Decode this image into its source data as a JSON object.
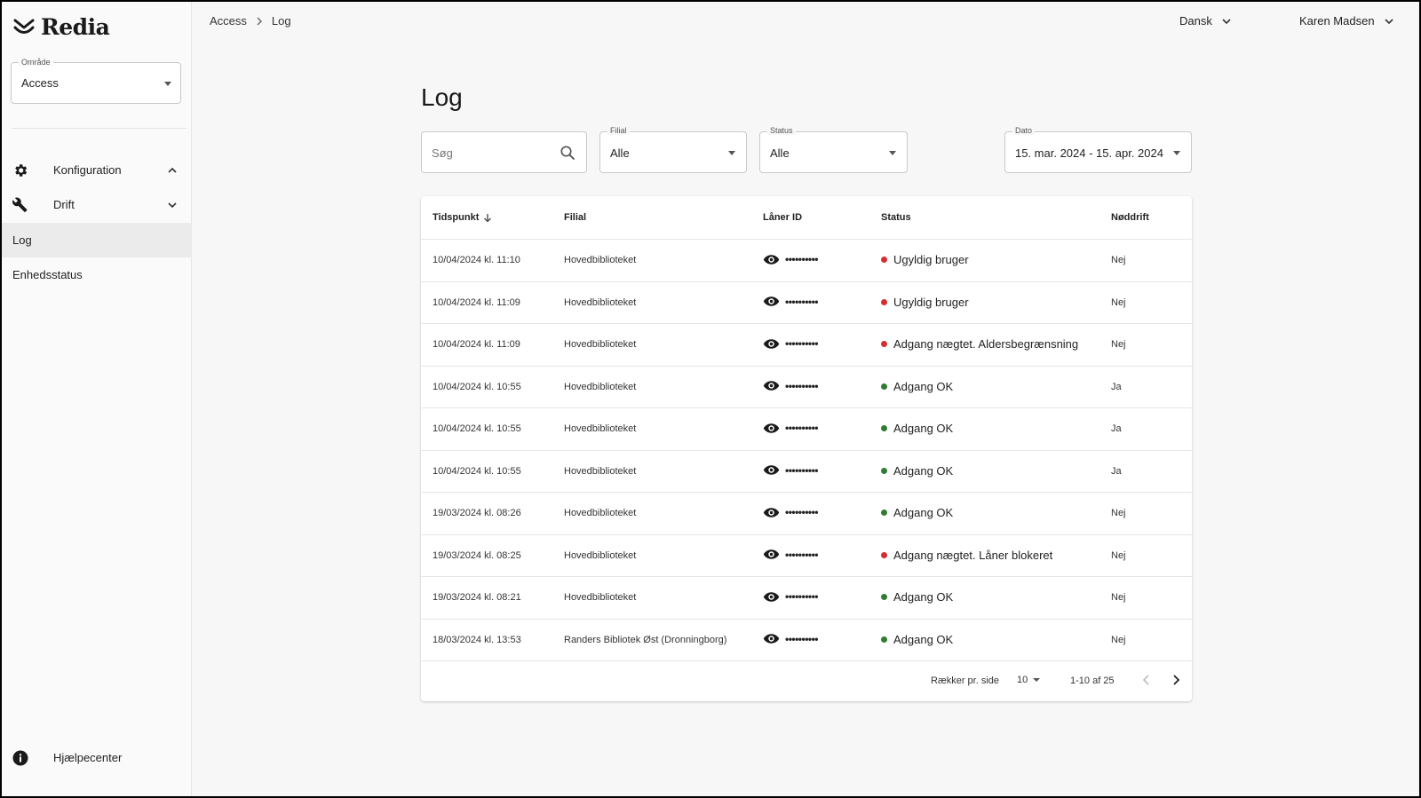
{
  "app": {
    "logo_text": "Redia"
  },
  "sidebar": {
    "area_legend": "Område",
    "area_value": "Access",
    "groups": [
      {
        "label": "Konfiguration",
        "icon": "gear-icon",
        "expanded": true
      },
      {
        "label": "Drift",
        "icon": "wrench-icon",
        "expanded": false
      }
    ],
    "items": [
      {
        "label": "Log",
        "active": true
      },
      {
        "label": "Enhedsstatus",
        "active": false
      }
    ],
    "help_label": "Hjælpecenter"
  },
  "topbar": {
    "breadcrumb": [
      "Access",
      "Log"
    ],
    "language": "Dansk",
    "user": "Karen Madsen"
  },
  "main": {
    "title": "Log",
    "filters": {
      "search_placeholder": "Søg",
      "branch_legend": "Filial",
      "branch_value": "Alle",
      "status_legend": "Status",
      "status_value": "Alle",
      "date_legend": "Dato",
      "date_value": "15. mar. 2024 - 15. apr. 2024"
    },
    "table": {
      "columns": [
        "Tidspunkt",
        "Filial",
        "Låner ID",
        "Status",
        "Nøddrift"
      ],
      "rows": [
        {
          "time": "10/04/2024 kl. 11:10",
          "branch": "Hovedbiblioteket",
          "loaner": "••••••••••",
          "status": "Ugyldig bruger",
          "ok": false,
          "emergency": "Nej"
        },
        {
          "time": "10/04/2024 kl. 11:09",
          "branch": "Hovedbiblioteket",
          "loaner": "••••••••••",
          "status": "Ugyldig bruger",
          "ok": false,
          "emergency": "Nej"
        },
        {
          "time": "10/04/2024 kl. 11:09",
          "branch": "Hovedbiblioteket",
          "loaner": "••••••••••",
          "status": "Adgang nægtet. Aldersbegrænsning",
          "ok": false,
          "emergency": "Nej"
        },
        {
          "time": "10/04/2024 kl. 10:55",
          "branch": "Hovedbiblioteket",
          "loaner": "••••••••••",
          "status": "Adgang OK",
          "ok": true,
          "emergency": "Ja"
        },
        {
          "time": "10/04/2024 kl. 10:55",
          "branch": "Hovedbiblioteket",
          "loaner": "••••••••••",
          "status": "Adgang OK",
          "ok": true,
          "emergency": "Ja"
        },
        {
          "time": "10/04/2024 kl. 10:55",
          "branch": "Hovedbiblioteket",
          "loaner": "••••••••••",
          "status": "Adgang OK",
          "ok": true,
          "emergency": "Ja"
        },
        {
          "time": "19/03/2024 kl. 08:26",
          "branch": "Hovedbiblioteket",
          "loaner": "••••••••••",
          "status": "Adgang OK",
          "ok": true,
          "emergency": "Nej"
        },
        {
          "time": "19/03/2024 kl. 08:25",
          "branch": "Hovedbiblioteket",
          "loaner": "••••••••••",
          "status": "Adgang nægtet. Låner blokeret",
          "ok": false,
          "emergency": "Nej"
        },
        {
          "time": "19/03/2024 kl. 08:21",
          "branch": "Hovedbiblioteket",
          "loaner": "••••••••••",
          "status": "Adgang OK",
          "ok": true,
          "emergency": "Nej"
        },
        {
          "time": "18/03/2024 kl. 13:53",
          "branch": "Randers Bibliotek Øst (Dronningborg)",
          "loaner": "••••••••••",
          "status": "Adgang OK",
          "ok": true,
          "emergency": "Nej"
        }
      ],
      "footer": {
        "rows_per_page_label": "Rækker pr. side",
        "rows_per_page_value": "10",
        "range": "1-10 af 25"
      }
    }
  },
  "colors": {
    "status_ok": "#2e7d32",
    "status_error": "#d32f2f"
  }
}
